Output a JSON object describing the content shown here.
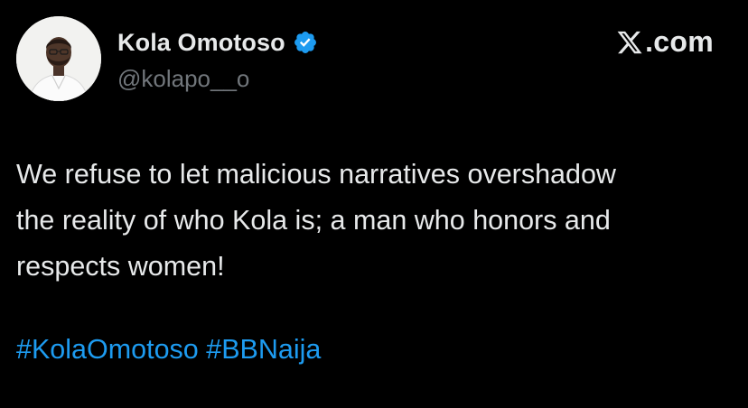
{
  "author": {
    "display_name": "Kola Omotoso",
    "handle": "@kolapo__o",
    "verified": true,
    "verified_icon": "verified-badge-icon",
    "avatar": "profile-photo"
  },
  "brand": {
    "icon": "x-logo-icon",
    "text": ".com"
  },
  "tweet": {
    "lines": [
      "We refuse to let malicious narratives overshadow",
      "the reality of who Kola is; a man who honors and",
      "respects women!"
    ],
    "hashtags": [
      "#KolaOmotoso",
      "#BBNaija"
    ]
  },
  "colors": {
    "background": "#000000",
    "text": "#e7e9ea",
    "secondary_text": "#71767b",
    "link": "#1d9bf0",
    "verified": "#1d9bf0"
  }
}
